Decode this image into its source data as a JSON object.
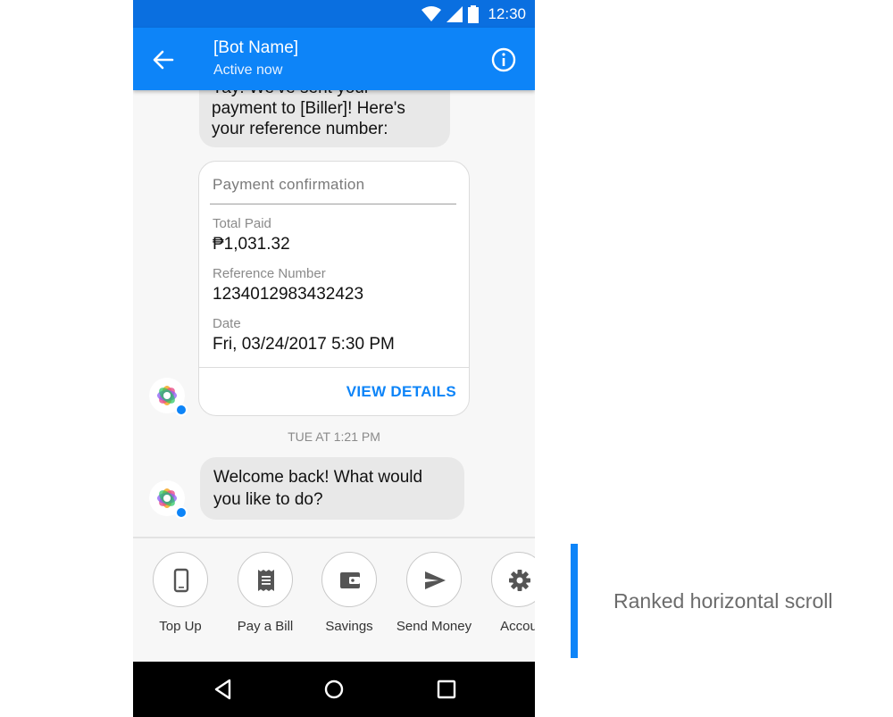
{
  "status_bar": {
    "time": "12:30"
  },
  "header": {
    "bot_name": "[Bot Name]",
    "status": "Active now"
  },
  "chat": {
    "message_1": "Yay! We've sent your payment to [Biller]! Here's your reference number:",
    "receipt": {
      "title": "Payment confirmation",
      "fields": [
        {
          "label": "Total Paid",
          "value": "₱1,031.32"
        },
        {
          "label": "Reference Number",
          "value": "1234012983432423"
        },
        {
          "label": "Date",
          "value": "Fri, 03/24/2017 5:30 PM"
        }
      ],
      "action_label": "VIEW DETAILS"
    },
    "timestamp": "TUE AT 1:21 PM",
    "message_2": "Welcome back! What would you like to do?"
  },
  "quick_actions": [
    {
      "label": "Top Up",
      "icon": "phone-icon"
    },
    {
      "label": "Pay a Bill",
      "icon": "receipt-icon"
    },
    {
      "label": "Savings",
      "icon": "wallet-icon"
    },
    {
      "label": "Send Money",
      "icon": "send-icon"
    },
    {
      "label": "Accou",
      "icon": "gear-icon"
    }
  ],
  "annotation": {
    "text": "Ranked horizontal scroll"
  },
  "colors": {
    "accent": "#0d84f8",
    "status_bar": "#0a6fe0",
    "bubble": "#e8e8e8",
    "nav": "#000000"
  }
}
